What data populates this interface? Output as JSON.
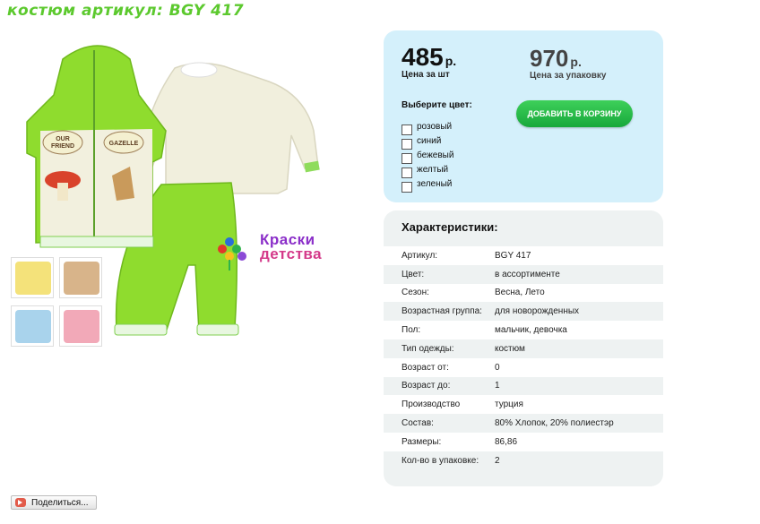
{
  "title": "костюм артикул: BGY 417",
  "brand": {
    "line1": "Краски",
    "line2": "детства"
  },
  "product_photo": {
    "vest_patch_left": "OUR FRIEND",
    "vest_patch_right": "GAZELLE"
  },
  "thumbnails": [
    {
      "color": "#f4e27a"
    },
    {
      "color": "#d8b48a"
    },
    {
      "color": "#a9d3ec"
    },
    {
      "color": "#f2a9b8"
    }
  ],
  "price": {
    "unit_value": "485",
    "unit_currency": "р.",
    "unit_label": "Цена за шт",
    "pack_value": "970",
    "pack_currency": "р.",
    "pack_label": "Цена за упаковку"
  },
  "color_select": {
    "title": "Выберите цвет:",
    "options": [
      "розовый",
      "синий",
      "бежевый",
      "желтый",
      "зеленый"
    ]
  },
  "cart_button": "ДОБАВИТЬ В КОРЗИНУ",
  "specs": {
    "title": "Характеристики:",
    "rows": [
      {
        "k": "Артикул:",
        "v": "BGY 417"
      },
      {
        "k": "Цвет:",
        "v": "в ассортименте"
      },
      {
        "k": "Сезон:",
        "v": "Весна, Лето"
      },
      {
        "k": "Возрастная группа:",
        "v": "для новорожденных"
      },
      {
        "k": "Пол:",
        "v": "мальчик, девочка"
      },
      {
        "k": "Тип одежды:",
        "v": "костюм"
      },
      {
        "k": "Возраст от:",
        "v": "0"
      },
      {
        "k": "Возраст до:",
        "v": "1"
      },
      {
        "k": "Производство",
        "v": "турция"
      },
      {
        "k": "Состав:",
        "v": "80% Хлопок, 20% полиестэр"
      },
      {
        "k": "Размеры:",
        "v": "86,86"
      },
      {
        "k": "Кол-во в упаковке:",
        "v": "2"
      }
    ]
  },
  "share_button": "Поделиться..."
}
